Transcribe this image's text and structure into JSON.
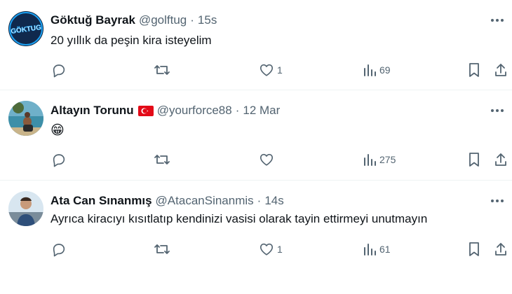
{
  "tweets": [
    {
      "name": "Göktuğ Bayrak",
      "handle": "@golftug",
      "separator": "·",
      "time": "15s",
      "avatar_text": "GÖKTUG",
      "text": "20 yıllık da peşin kira isteyelim",
      "replies": "",
      "reposts": "",
      "likes": "1",
      "views": "69"
    },
    {
      "name": "Altayın Torunu",
      "handle": "@yourforce88",
      "separator": "·",
      "time": "12 Mar",
      "has_flag": "turkish-flag",
      "text": "😁",
      "replies": "",
      "reposts": "",
      "likes": "",
      "views": "275"
    },
    {
      "name": "Ata Can Sınanmış",
      "handle": "@AtacanSinanmis",
      "separator": "·",
      "time": "14s",
      "text": "Ayrıca kiracıyı kısıtlatıp kendinizi vasisi olarak tayin ettirmeyi unutmayın",
      "replies": "",
      "reposts": "",
      "likes": "1",
      "views": "61"
    }
  ],
  "colors": {
    "text": "#0f1419",
    "secondary": "#536471",
    "divider": "#eff3f4",
    "flag_red": "#e30a17"
  },
  "icons": [
    "more-icon",
    "reply-icon",
    "repost-icon",
    "like-icon",
    "views-icon",
    "bookmark-icon",
    "share-icon"
  ]
}
